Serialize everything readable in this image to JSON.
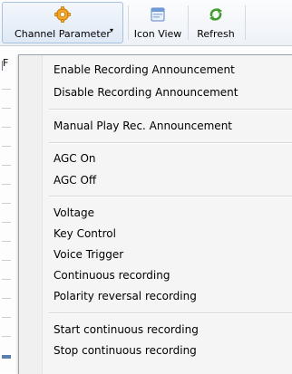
{
  "toolbar": {
    "channel_parameter": "Channel Parameter",
    "icon_view": "Icon View",
    "refresh": "Refresh",
    "dropdown_arrow": "▾"
  },
  "underlying": {
    "column_letter": "F"
  },
  "menu": {
    "groups": [
      [
        "Enable Recording Announcement",
        "Disable Recording Announcement"
      ],
      [
        "Manual Play Rec. Announcement"
      ],
      [
        "AGC On",
        "AGC Off"
      ],
      [
        "Voltage",
        "Key Control",
        "Voice Trigger",
        "Continuous recording",
        "Polarity reversal recording"
      ],
      [
        "Start continuous recording",
        "Stop continuous recording"
      ]
    ]
  }
}
